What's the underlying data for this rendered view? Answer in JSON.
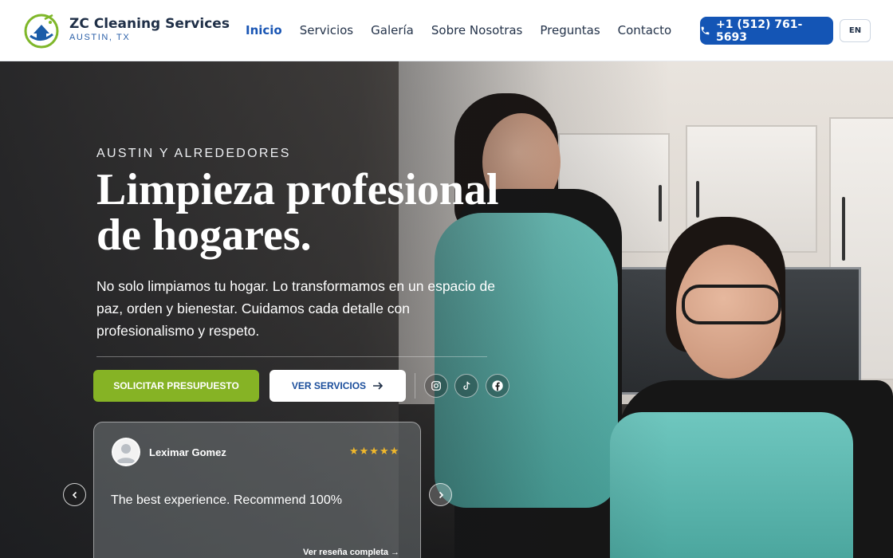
{
  "header": {
    "brand_name": "ZC Cleaning Services",
    "brand_location": "AUSTIN, TX",
    "nav": [
      {
        "label": "Inicio",
        "active": true
      },
      {
        "label": "Servicios",
        "active": false
      },
      {
        "label": "Galería",
        "active": false
      },
      {
        "label": "Sobre Nosotras",
        "active": false
      },
      {
        "label": "Preguntas",
        "active": false
      },
      {
        "label": "Contacto",
        "active": false
      }
    ],
    "phone": "+1 (512) 761-5693",
    "language_toggle": "EN"
  },
  "hero": {
    "eyebrow": "AUSTIN Y ALREDEDORES",
    "headline_line1": "Limpieza profesional",
    "headline_line2": "de hogares.",
    "subtext": "No solo limpiamos tu hogar. Lo transformamos en un espacio de paz, orden y bienestar. Cuidamos cada detalle con profesionalismo y respeto.",
    "primary_cta": "SOLICITAR PRESUPUESTO",
    "secondary_cta": "VER SERVICIOS",
    "social_icons": [
      "instagram-icon",
      "tiktok-icon",
      "facebook-icon"
    ]
  },
  "review": {
    "name": "Leximar Gomez",
    "stars": "★★★★★",
    "rating": 5,
    "text": "The best experience. Recommend 100%",
    "link": "Ver reseña completa →"
  },
  "colors": {
    "brand_blue": "#1455b5",
    "accent_green": "#86b325",
    "star_gold": "#f1b82b",
    "nav_active": "#1a56b4"
  }
}
